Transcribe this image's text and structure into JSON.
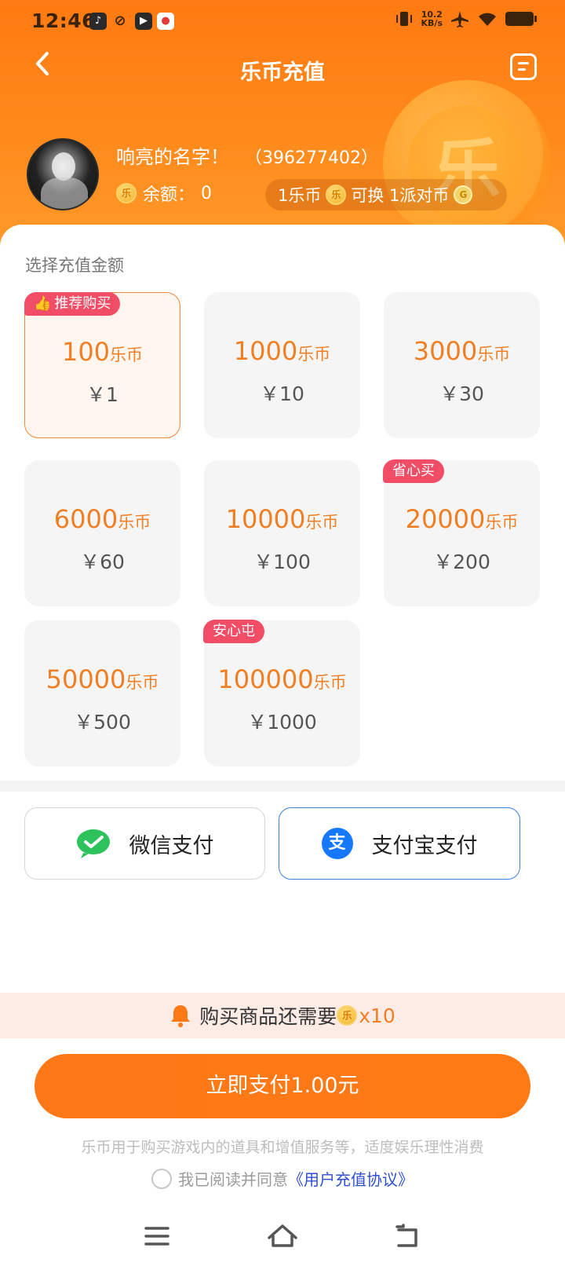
{
  "status_bar": {
    "time": "12:46",
    "apps": [
      "tiktok-icon",
      "sport-app-icon",
      "video-app-icon",
      "pin-app-icon"
    ],
    "net_speed_value": "10.2",
    "net_speed_unit": "KB/s"
  },
  "header": {
    "title": "乐币充值",
    "big_coin_glyph": "乐"
  },
  "profile": {
    "name": "响亮的名字！",
    "uid": "（396277402）",
    "balance_label": "余额：",
    "balance_value": "0",
    "coin_glyph": "乐",
    "exchange_left": "1乐币",
    "exchange_right": "可换 1派对币",
    "party_coin_glyph": "G"
  },
  "recharge": {
    "section_label": "选择充值金额",
    "coin_unit": "乐币",
    "packages": [
      {
        "coins": "100",
        "price": "￥1",
        "badge": "推荐购买",
        "selected": true
      },
      {
        "coins": "1000",
        "price": "￥10",
        "badge": ""
      },
      {
        "coins": "3000",
        "price": "￥30",
        "badge": ""
      },
      {
        "coins": "6000",
        "price": "￥60",
        "badge": ""
      },
      {
        "coins": "10000",
        "price": "￥100",
        "badge": ""
      },
      {
        "coins": "20000",
        "price": "￥200",
        "badge": "省心买"
      },
      {
        "coins": "50000",
        "price": "￥500",
        "badge": ""
      },
      {
        "coins": "100000",
        "price": "￥1000",
        "badge": "安心屯"
      }
    ]
  },
  "payment": {
    "wechat_label": "微信支付",
    "alipay_label": "支付宝支付",
    "alipay_glyph": "支",
    "selected": "alipay"
  },
  "notice": {
    "text": "购买商品还需要",
    "coin_glyph": "乐",
    "amount": "x10"
  },
  "footer": {
    "pay_button": "立即支付1.00元",
    "disclaimer": "乐币用于购买游戏内的道具和增值服务等，适度娱乐理性消费",
    "agree_text": "我已阅读并同意",
    "agree_link": "《用户充值协议》"
  },
  "colors": {
    "accent": "#ff7a14",
    "badge": "#f24d66",
    "alipay_border": "#3d7fe0",
    "link": "#2f4fd1"
  }
}
